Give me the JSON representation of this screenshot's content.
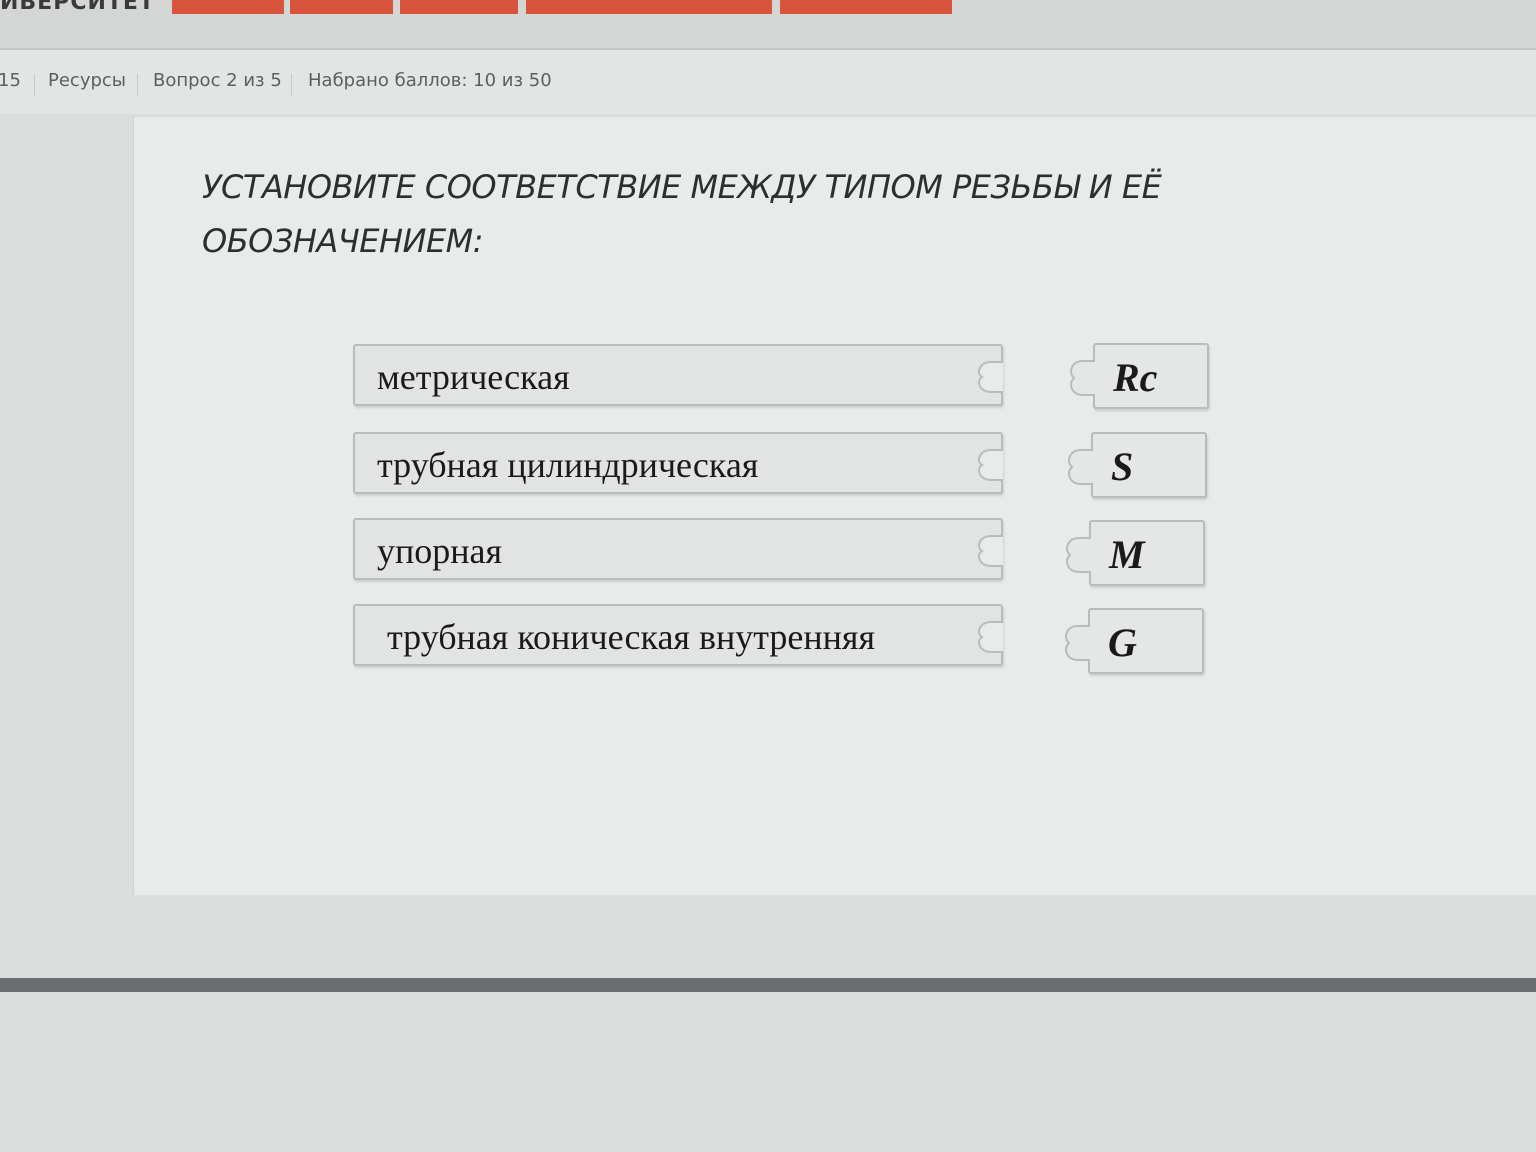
{
  "header": {
    "brand_text": "ИВЕРСИТЕТ"
  },
  "info_bar": {
    "left_fragment": "15",
    "resources": "Ресурсы",
    "question_counter": "Вопрос 2 из 5",
    "score": "Набрано баллов: 10 из 50"
  },
  "question": {
    "line1": "УСТАНОВИТЕ СООТВЕТСТВИЕ МЕЖДУ ТИПОМ РЕЗЬБЫ И ЕЁ",
    "line2": "ОБОЗНАЧЕНИЕМ:"
  },
  "matching": {
    "left_items": [
      {
        "label": "метрическая"
      },
      {
        "label": "трубная цилиндрическая"
      },
      {
        "label": "упорная"
      },
      {
        "label": "трубная коническая внутренняя"
      }
    ],
    "right_items": [
      {
        "label": "Rc"
      },
      {
        "label": "S"
      },
      {
        "label": "M"
      },
      {
        "label": "G"
      }
    ]
  },
  "colors": {
    "accent": "#d8543c",
    "text": "#2c2e30",
    "piece_border": "#b9bcbc"
  }
}
